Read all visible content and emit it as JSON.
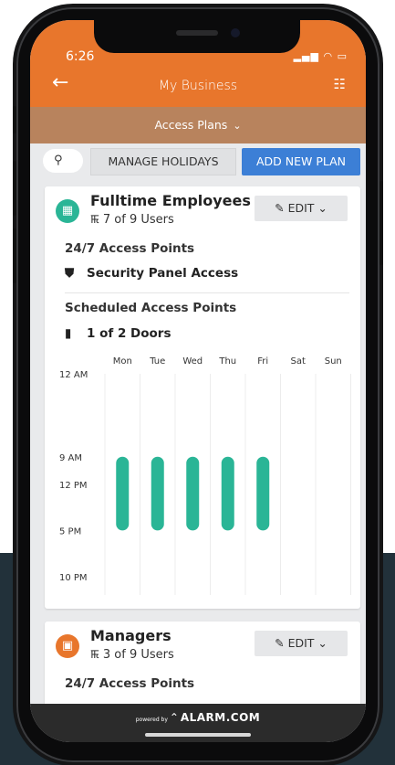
{
  "status_bar": {
    "time": "6:26"
  },
  "header": {
    "title": "My Business"
  },
  "subheader": {
    "label": "Access Plans"
  },
  "toolbar": {
    "manage_label": "MANAGE HOLIDAYS",
    "add_label": "ADD NEW PLAN"
  },
  "plans": [
    {
      "name": "Fulltime Employees",
      "users": "7 of 9 Users",
      "edit_label": "EDIT",
      "icon_color": "#2ab596",
      "section_247": "24/7 Access Points",
      "item_247": "Security Panel Access",
      "section_sched": "Scheduled Access Points",
      "item_sched": "1 of 2 Doors"
    },
    {
      "name": "Managers",
      "users": "3 of 9 Users",
      "edit_label": "EDIT",
      "icon_color": "#e8762c",
      "section_247": "24/7 Access Points"
    }
  ],
  "colors": {
    "header": "#e8762c",
    "subheader": "#b8835d",
    "accent_blue": "#3c7fd6",
    "bar": "#2ab596"
  },
  "chart_data": {
    "type": "bar",
    "categories": [
      "Mon",
      "Tue",
      "Wed",
      "Thu",
      "Fri",
      "Sat",
      "Sun"
    ],
    "y_tick_labels": [
      "12 AM",
      "9 AM",
      "12 PM",
      "5 PM",
      "10 PM"
    ],
    "y_tick_hours": [
      0,
      9,
      12,
      17,
      22
    ],
    "series": [
      {
        "values_start_hour": [
          9,
          9,
          9,
          9,
          9,
          null,
          null
        ],
        "values_end_hour": [
          17,
          17,
          17,
          17,
          17,
          null,
          null
        ]
      }
    ],
    "ylim": [
      0,
      24
    ]
  },
  "footer": {
    "powered_by": "powered by",
    "brand": "ALARM.COM"
  }
}
